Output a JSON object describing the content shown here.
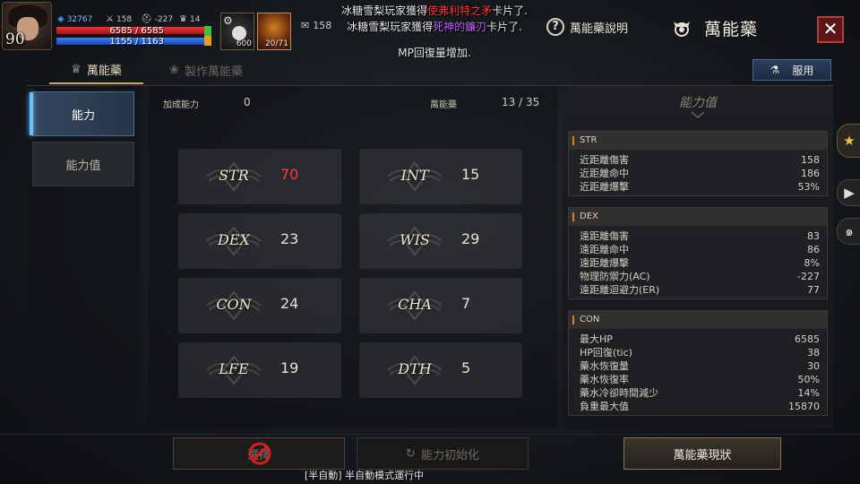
{
  "hud": {
    "level": "90",
    "combat_power": "32767",
    "attack": "158",
    "defense": "-227",
    "trophy": "14",
    "hp_text": "6585 / 6585",
    "mp_text": "1155 / 1163",
    "hp_ratio": 1.0,
    "mp_ratio": 0.993,
    "slot1_count": "600",
    "slot2_count": "20/71",
    "ticket_count": "158"
  },
  "chat": {
    "line1_prefix": "冰糖雪梨玩家獲得",
    "line1_item": "使弗利特之矛",
    "line1_suffix": "卡片了.",
    "line2_prefix": "冰糖雪梨玩家獲得",
    "line2_item": "死神的鐮刃",
    "line2_suffix": "卡片了.",
    "system": "MP回復量增加."
  },
  "header": {
    "help_label": "萬能藥說明",
    "title": "萬能藥",
    "close_symbol": "✕"
  },
  "tabs": {
    "elixir": "萬能藥",
    "craft": "製作萬能藥",
    "use": "服用"
  },
  "nav": {
    "ability": "能力",
    "values": "能力值"
  },
  "main": {
    "bonus_label": "加成能力",
    "bonus_value": "0",
    "pot_label": "萬能藥",
    "pot_value": "13 / 35"
  },
  "stats": [
    {
      "name": "STR",
      "value": "70",
      "highlight": true
    },
    {
      "name": "INT",
      "value": "15",
      "highlight": false
    },
    {
      "name": "DEX",
      "value": "23",
      "highlight": false
    },
    {
      "name": "WIS",
      "value": "29",
      "highlight": false
    },
    {
      "name": "CON",
      "value": "24",
      "highlight": false
    },
    {
      "name": "CHA",
      "value": "7",
      "highlight": false
    },
    {
      "name": "LFE",
      "value": "19",
      "highlight": false
    },
    {
      "name": "DTH",
      "value": "5",
      "highlight": false
    }
  ],
  "right": {
    "title": "能力值",
    "sections": [
      {
        "head": "STR",
        "rows": [
          {
            "label": "近距離傷害",
            "value": "158"
          },
          {
            "label": "近距離命中",
            "value": "186"
          },
          {
            "label": "近距離爆擊",
            "value": "53%"
          }
        ]
      },
      {
        "head": "DEX",
        "rows": [
          {
            "label": "遠距離傷害",
            "value": "83"
          },
          {
            "label": "遠距離命中",
            "value": "86"
          },
          {
            "label": "遠距離爆擊",
            "value": "8%"
          },
          {
            "label": "物理防禦力(AC)",
            "value": "-227"
          },
          {
            "label": "遠距離迴避力(ER)",
            "value": "77"
          }
        ]
      },
      {
        "head": "CON",
        "rows": [
          {
            "label": "最大HP",
            "value": "6585"
          },
          {
            "label": "HP回復(tic)",
            "value": "38"
          },
          {
            "label": "藥水恢復量",
            "value": "30"
          },
          {
            "label": "藥水恢復率",
            "value": "50%"
          },
          {
            "label": "藥水冷卻時間減少",
            "value": "14%"
          },
          {
            "label": "負重最大值",
            "value": "15870"
          }
        ]
      }
    ]
  },
  "bottom": {
    "apply": "選擇",
    "reset": "能力初始化",
    "status": "萬能藥現狀",
    "auto": "[半自動] 半自動模式運行中"
  },
  "colors": {
    "highlight_red": "#ff3a3a",
    "accent_orange": "#e07a28",
    "active_tab_blue": "#6ac0ff"
  }
}
